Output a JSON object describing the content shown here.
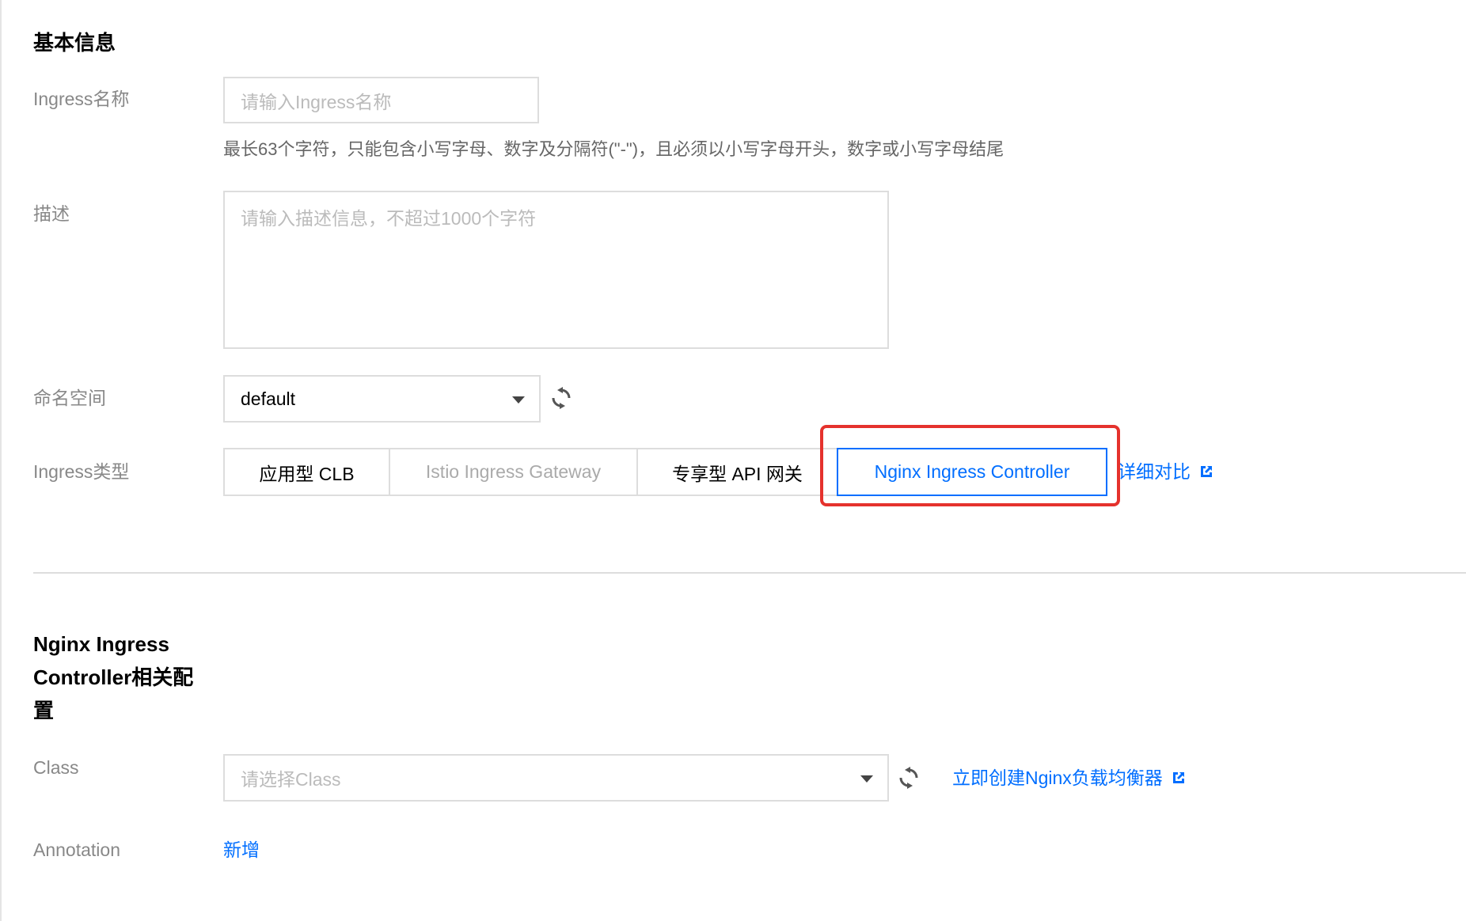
{
  "basic": {
    "title": "基本信息",
    "name_label": "Ingress名称",
    "name_placeholder": "请输入Ingress名称",
    "name_hint": "最长63个字符，只能包含小写字母、数字及分隔符(\"-\")，且必须以小写字母开头，数字或小写字母结尾",
    "desc_label": "描述",
    "desc_placeholder": "请输入描述信息，不超过1000个字符",
    "namespace_label": "命名空间",
    "namespace_value": "default",
    "type_label": "Ingress类型",
    "types": [
      {
        "label": "应用型 CLB",
        "state": "normal"
      },
      {
        "label": "Istio Ingress Gateway",
        "state": "disabled"
      },
      {
        "label": "专享型 API 网关",
        "state": "normal"
      },
      {
        "label": "Nginx Ingress Controller",
        "state": "selected"
      }
    ],
    "compare_link": "详细对比"
  },
  "nginx": {
    "title_line1": "Nginx Ingress",
    "title_line2": "Controller相关配",
    "title_line3": "置",
    "class_label": "Class",
    "class_placeholder": "请选择Class",
    "create_link": "立即创建Nginx负载均衡器",
    "annotation_label": "Annotation",
    "annotation_add": "新增"
  },
  "colors": {
    "accent": "#006eff",
    "highlight": "#e5322d",
    "border": "#dddddd",
    "label": "#888888"
  },
  "icons": [
    "refresh-icon",
    "chevron-down-icon",
    "external-link-icon"
  ]
}
